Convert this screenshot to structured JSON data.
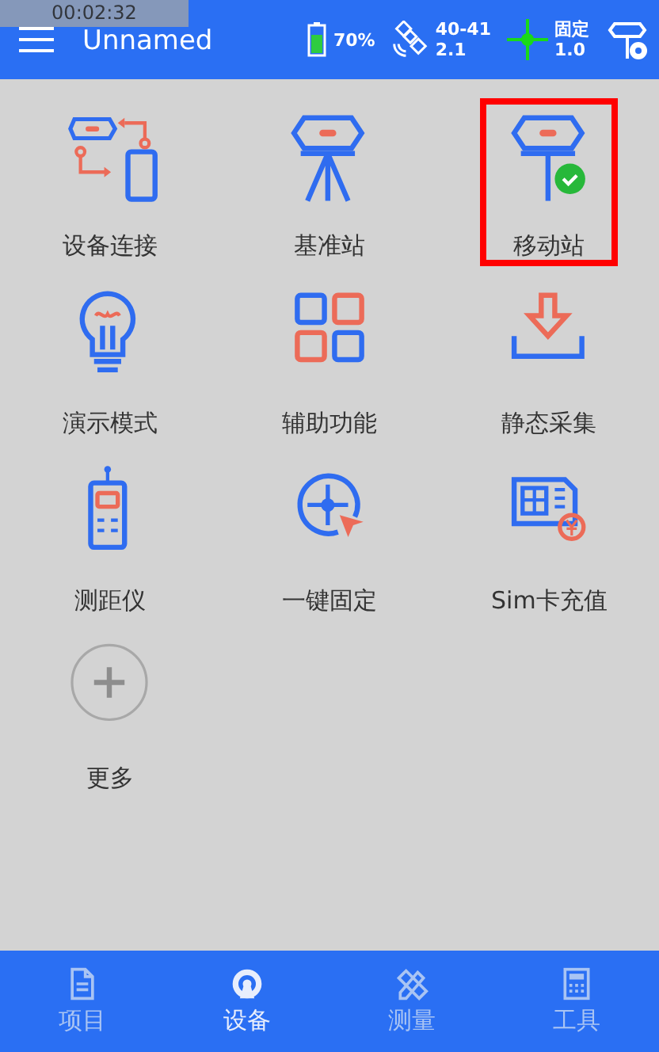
{
  "recording_time": "00:02:32",
  "header": {
    "title": "Unnamed",
    "battery": "70%",
    "satellites": "40-41",
    "pdop": "2.1",
    "solution": "固定",
    "age": "1.0"
  },
  "tiles": [
    {
      "kind": "connect",
      "label": "设备连接",
      "highlighted": false
    },
    {
      "kind": "base",
      "label": "基准站",
      "highlighted": false
    },
    {
      "kind": "rover",
      "label": "移动站",
      "highlighted": true
    },
    {
      "kind": "demo",
      "label": "演示模式",
      "highlighted": false
    },
    {
      "kind": "assist",
      "label": "辅助功能",
      "highlighted": false
    },
    {
      "kind": "static",
      "label": "静态采集",
      "highlighted": false
    },
    {
      "kind": "range",
      "label": "测距仪",
      "highlighted": false
    },
    {
      "kind": "fix",
      "label": "一键固定",
      "highlighted": false
    },
    {
      "kind": "sim",
      "label": "Sim卡充值",
      "highlighted": false
    },
    {
      "kind": "more",
      "label": "更多",
      "highlighted": false
    }
  ],
  "nav": [
    {
      "kind": "project",
      "label": "项目",
      "selected": false
    },
    {
      "kind": "device",
      "label": "设备",
      "selected": true
    },
    {
      "kind": "survey",
      "label": "测量",
      "selected": false
    },
    {
      "kind": "tools",
      "label": "工具",
      "selected": false
    }
  ]
}
